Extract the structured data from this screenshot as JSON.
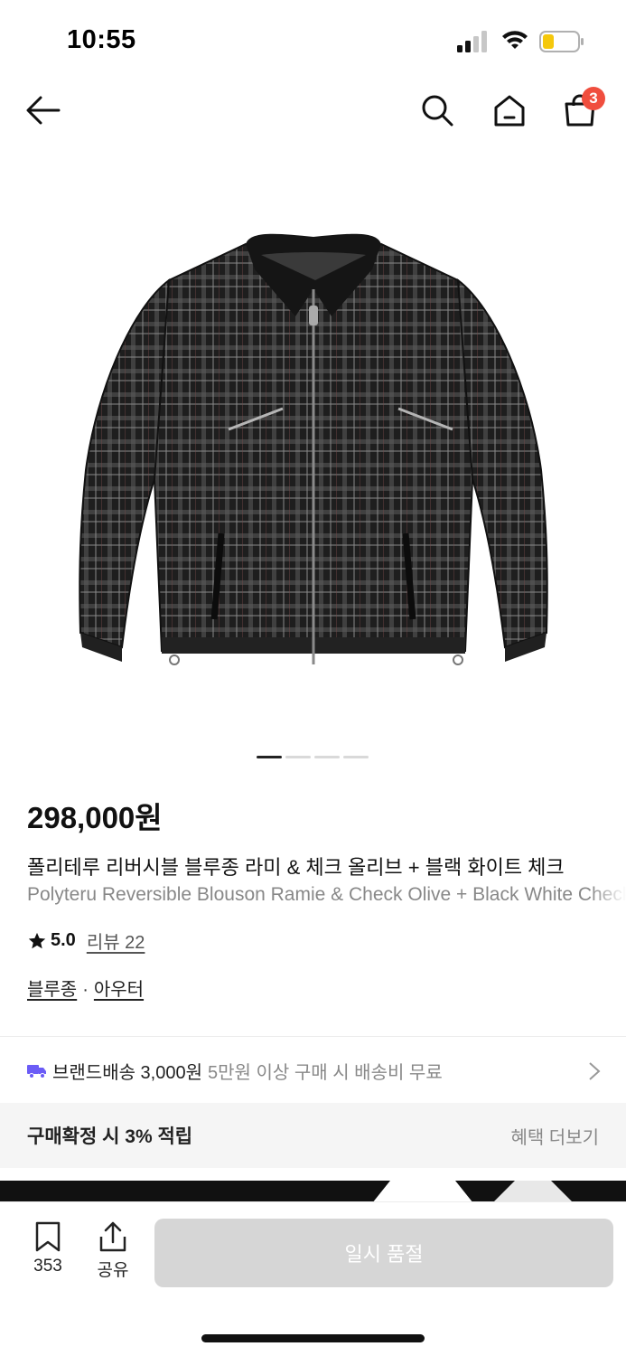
{
  "status_bar": {
    "time": "10:55"
  },
  "header": {
    "cart_count": "3"
  },
  "gallery": {
    "total_images": 4,
    "active_index": 0
  },
  "product": {
    "price": "298,000원",
    "title_ko": "폴리테루 리버시블 블루종 라미 & 체크 올리브 + 블랙 화이트 체크",
    "title_en": "Polyteru Reversible Blouson Ramie & Check Olive + Black White Check",
    "rating": "5.0",
    "review_label": "리뷰 22",
    "categories": [
      "블루종",
      "아우터"
    ],
    "category_sep": "·"
  },
  "shipping": {
    "label": "브랜드배송 3,000원",
    "desc": "5만원 이상 구매 시 배송비 무료"
  },
  "benefit": {
    "text": "구매확정 시 3% 적립",
    "more": "혜택 더보기"
  },
  "bottom": {
    "bookmark_count": "353",
    "share_label": "공유",
    "buy_label": "일시 품절"
  },
  "colors": {
    "badge": "#f04e3e",
    "truck": "#6b5cf6",
    "disabled_button": "#d6d6d6"
  }
}
